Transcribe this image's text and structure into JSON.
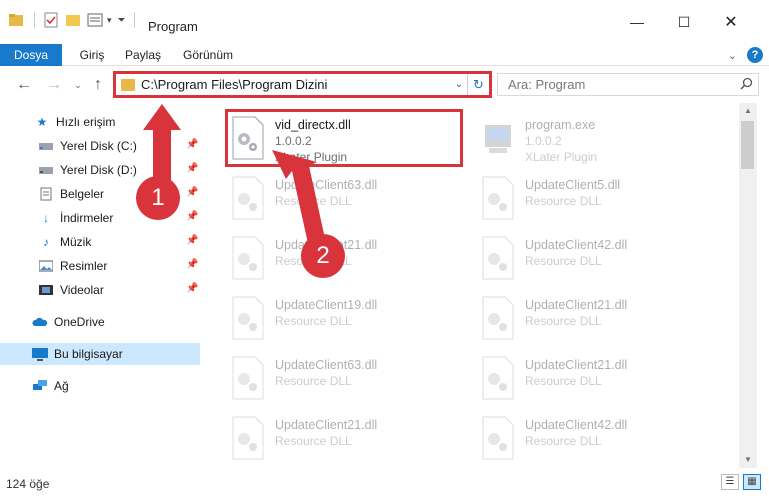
{
  "window": {
    "title": "Program"
  },
  "ribbon": {
    "tabs": [
      "Dosya",
      "Giriş",
      "Paylaş",
      "Görünüm"
    ]
  },
  "address": {
    "path": "C:\\Program Files\\Program Dizini"
  },
  "search": {
    "placeholder": "Ara: Program"
  },
  "sidebar": {
    "items": [
      {
        "label": "Hızlı erişim",
        "icon": "star-icon"
      },
      {
        "label": "Yerel Disk (C:)",
        "icon": "drive-icon",
        "pinned": true
      },
      {
        "label": "Yerel Disk (D:)",
        "icon": "drive-icon",
        "pinned": true
      },
      {
        "label": "Belgeler",
        "icon": "documents-icon",
        "pinned": true
      },
      {
        "label": "İndirmeler",
        "icon": "download-icon",
        "pinned": true
      },
      {
        "label": "Müzik",
        "icon": "music-icon",
        "pinned": true
      },
      {
        "label": "Resimler",
        "icon": "pictures-icon",
        "pinned": true
      },
      {
        "label": "Videolar",
        "icon": "video-icon",
        "pinned": true
      },
      {
        "label": "OneDrive",
        "icon": "cloud-icon"
      },
      {
        "label": "Bu bilgisayar",
        "icon": "computer-icon",
        "selected": true
      },
      {
        "label": "Ağ",
        "icon": "network-icon"
      }
    ]
  },
  "files": [
    {
      "name": "vid_directx.dll",
      "line2": "1.0.0.2",
      "line3": "XLater Plugin",
      "selected": true
    },
    {
      "name": "program.exe",
      "line2": "1.0.0.2",
      "line3": "XLater Plugin"
    },
    {
      "name": "UpdateClient63.dll",
      "line2": "Resource DLL"
    },
    {
      "name": "UpdateClient5.dll",
      "line2": "Resource DLL"
    },
    {
      "name": "UpdateClient21.dll",
      "line2": "Resource DLL"
    },
    {
      "name": "UpdateClient42.dll",
      "line2": "Resource DLL"
    },
    {
      "name": "UpdateClient19.dll",
      "line2": "Resource DLL"
    },
    {
      "name": "UpdateClient21.dll",
      "line2": "Resource DLL"
    },
    {
      "name": "UpdateClient63.dll",
      "line2": "Resource DLL"
    },
    {
      "name": "UpdateClient21.dll",
      "line2": "Resource DLL"
    },
    {
      "name": "UpdateClient21.dll",
      "line2": "Resource DLL"
    },
    {
      "name": "UpdateClient42.dll",
      "line2": "Resource DLL"
    }
  ],
  "status": {
    "count": "124 öğe"
  },
  "annotations": {
    "step1": "1",
    "step2": "2"
  },
  "colors": {
    "accent": "#1979ca",
    "highlight": "#d9343b",
    "folder": "#e8b84b"
  }
}
